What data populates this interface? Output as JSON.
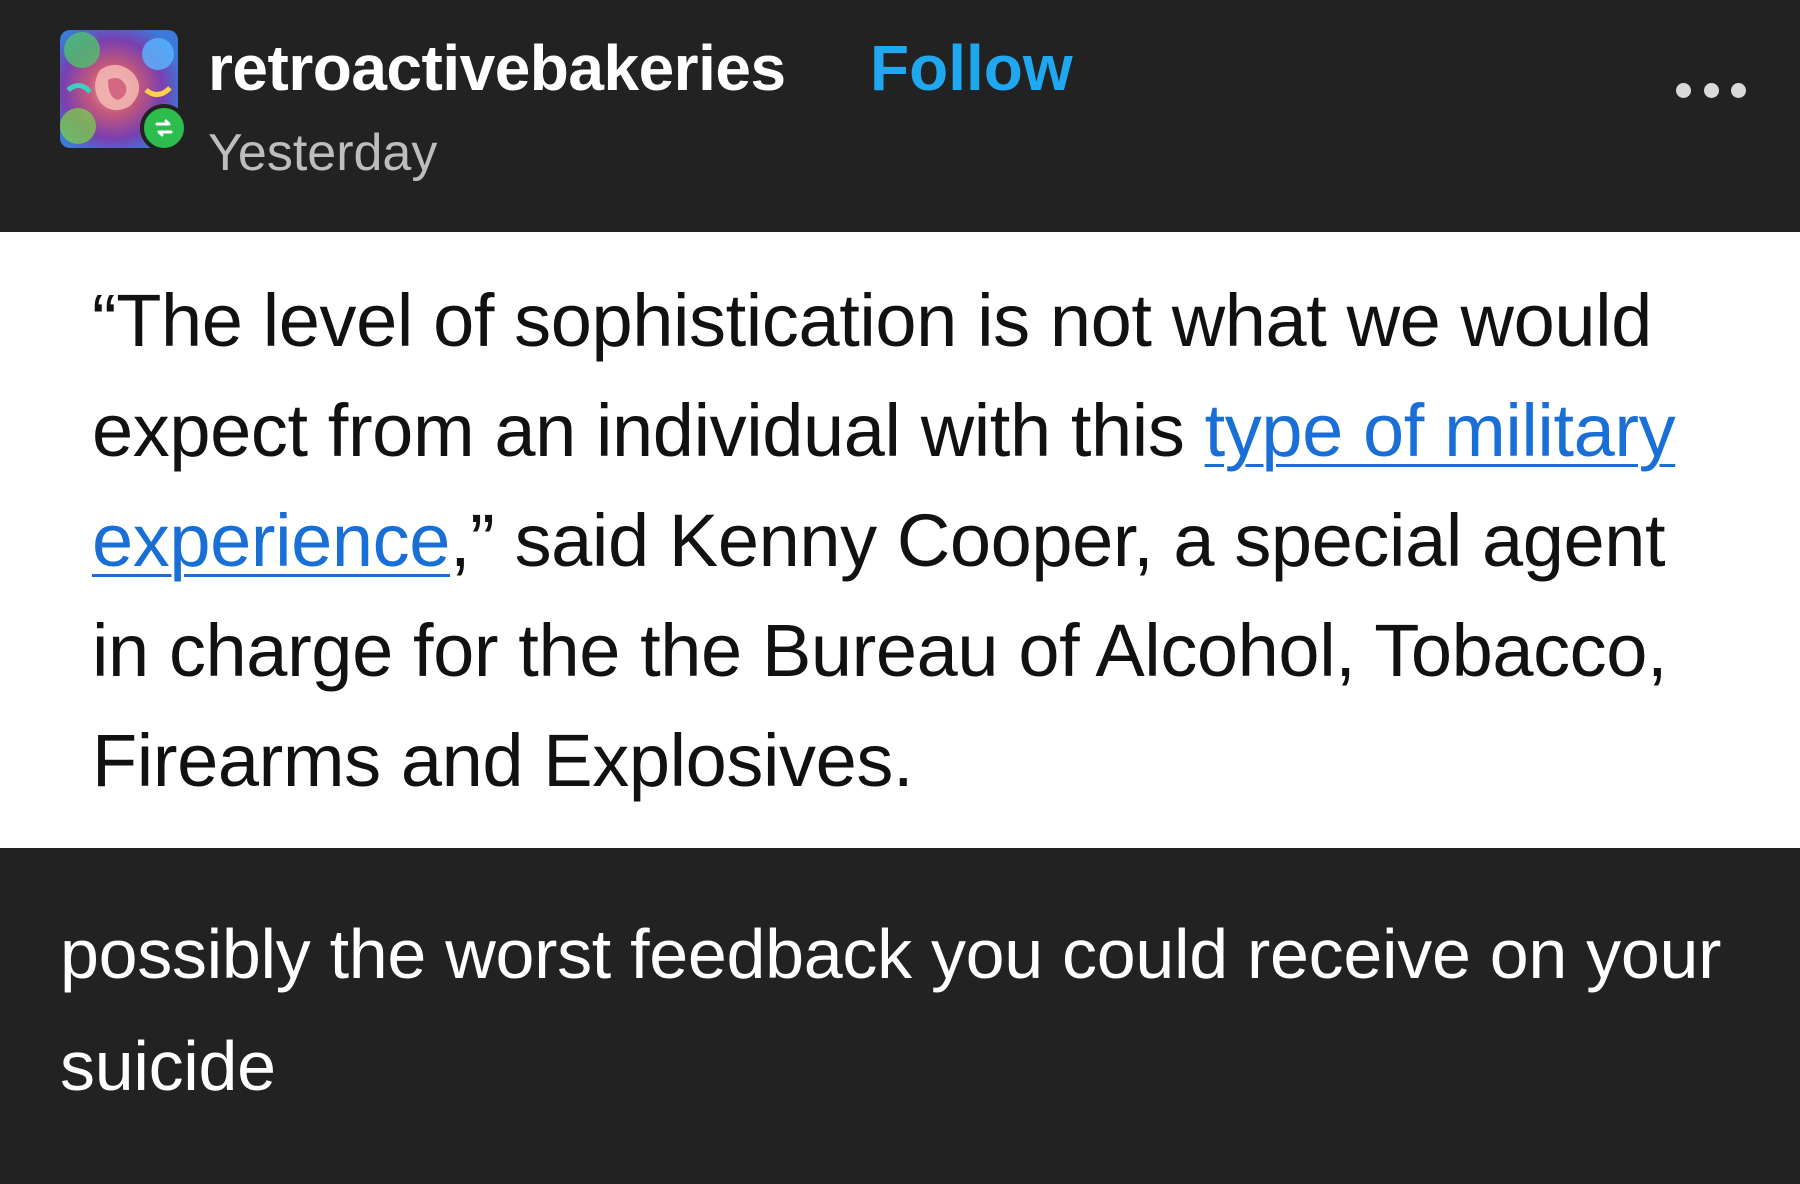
{
  "post": {
    "username": "retroactivebakeries",
    "follow_label": "Follow",
    "timestamp": "Yesterday",
    "avatar_icon": "avatar-image",
    "reblog_icon": "reblog-icon",
    "more_icon": "more-options-icon"
  },
  "quote": {
    "before_link": "“The level of sophistication is not what we would expect from an individual with this ",
    "link_text": "type of military experience",
    "after_link": ",” said Kenny Cooper, a special agent in charge for the the Bureau of Alcohol, Tobacco, Firearms and Explosives."
  },
  "caption": {
    "text": "possibly the worst feedback you could receive on your suicide"
  },
  "colors": {
    "background": "#222222",
    "follow": "#1fa7f0",
    "link": "#1a6fd6",
    "reblog_badge": "#2dbd4e"
  }
}
